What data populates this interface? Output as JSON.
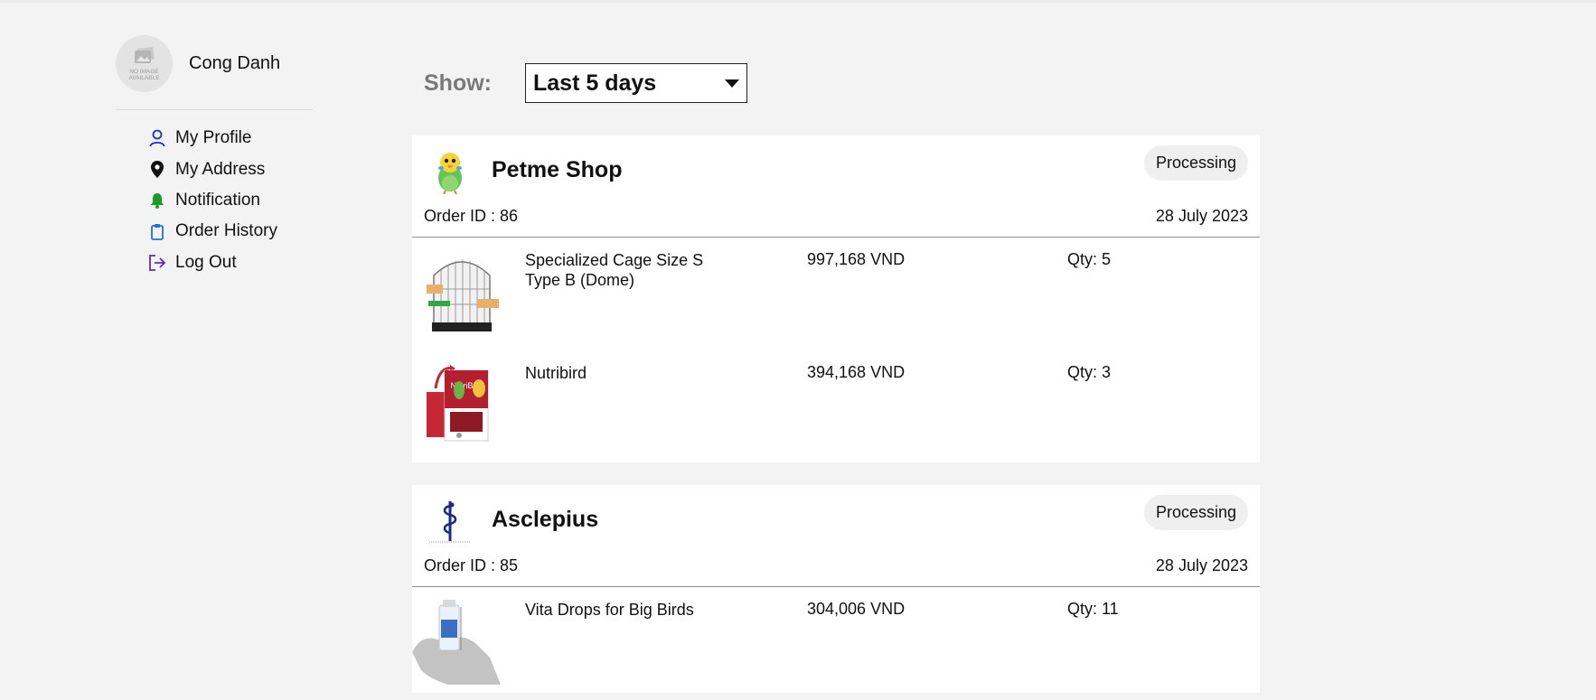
{
  "user": {
    "name": "Cong Danh",
    "avatar_text": "NO IMAGE AVAILABLE"
  },
  "menu": [
    {
      "label": "My Profile",
      "icon": "user-icon",
      "color": "#1a33c9"
    },
    {
      "label": "My Address",
      "icon": "location-pin-icon",
      "color": "#111111"
    },
    {
      "label": "Notification",
      "icon": "bell-icon",
      "color": "#1f9a2a"
    },
    {
      "label": "Order History",
      "icon": "clipboard-icon",
      "color": "#1e6fe0"
    },
    {
      "label": "Log Out",
      "icon": "logout-icon",
      "color": "#5b2bd6"
    }
  ],
  "filter": {
    "label": "Show:",
    "selected": "Last 5 days"
  },
  "orders": [
    {
      "shop": "Petme Shop",
      "shop_icon": "parrot-logo",
      "status": "Processing",
      "order_id": "Order ID : 86",
      "date": "28 July 2023",
      "items": [
        {
          "name": "Specialized Cage Size S Type B (Dome)",
          "price": "997,168 VND",
          "qty": "Qty: 5",
          "image": "bird-cage-image"
        },
        {
          "name": "Nutribird",
          "price": "394,168 VND",
          "qty": "Qty: 3",
          "image": "nutribird-package-image"
        }
      ]
    },
    {
      "shop": "Asclepius",
      "shop_icon": "rod-of-asclepius-logo",
      "status": "Processing",
      "order_id": "Order ID : 85",
      "date": "28 July 2023",
      "items": [
        {
          "name": "Vita Drops for Big Birds",
          "price": "304,006 VND",
          "qty": "Qty: 11",
          "image": "vita-drops-bottle-image"
        }
      ]
    }
  ]
}
